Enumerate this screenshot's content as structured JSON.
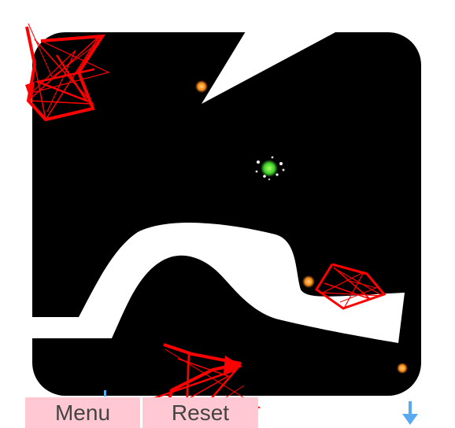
{
  "controls": {
    "menu_label": "Menu",
    "reset_label": "Reset"
  },
  "icons": {
    "scroll": "arrow-down-icon"
  },
  "colors": {
    "playfield": "#000000",
    "background": "#ffffff",
    "button": "#ffc8d2",
    "button_text": "#444444",
    "hazard": "#ff0000",
    "player": "#55dd33",
    "collectible": "#ff8c1a",
    "arrow": "#5aaaf0"
  }
}
